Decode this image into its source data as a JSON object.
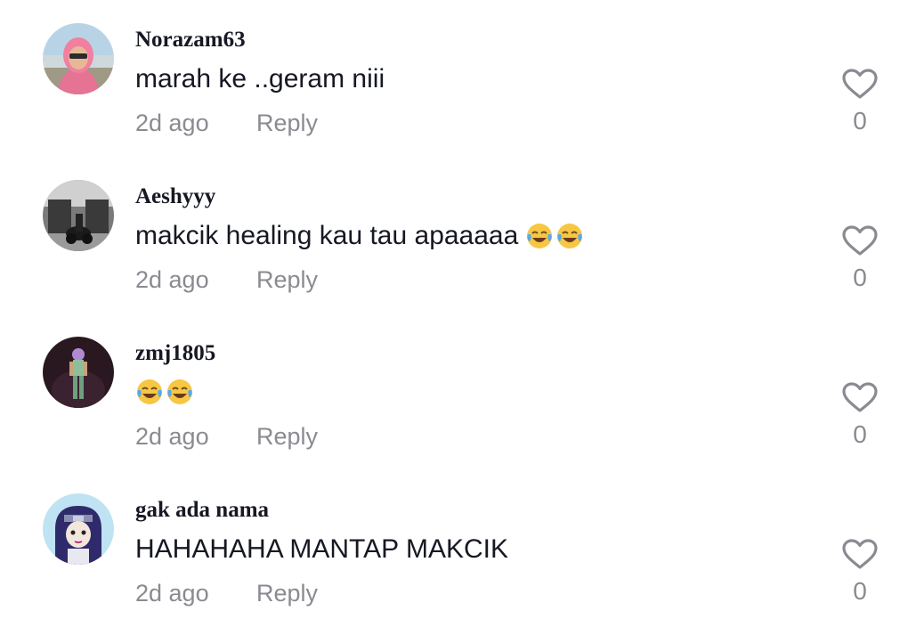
{
  "icons": {
    "like": "heart-outline-icon",
    "emoji": "face-with-tears-of-joy-emoji"
  },
  "colors": {
    "text": "#161823",
    "secondary": "#8a8b91"
  },
  "comments": [
    {
      "username": "Norazam63",
      "text": "marah ke ..geram niii",
      "emoji_count": 0,
      "time": "2d ago",
      "reply_label": "Reply",
      "likes": "0"
    },
    {
      "username": "Aeshyyy",
      "text": "makcik healing kau tau apaaaaa",
      "emoji_count": 2,
      "time": "2d ago",
      "reply_label": "Reply",
      "likes": "0"
    },
    {
      "username": "zmj1805",
      "text": "",
      "emoji_count": 2,
      "time": "2d ago",
      "reply_label": "Reply",
      "likes": "0"
    },
    {
      "username": "gak ada nama",
      "text": "HAHAHAHA MANTAP MAKCIK",
      "emoji_count": 0,
      "time": "2d ago",
      "reply_label": "Reply",
      "likes": "0"
    }
  ]
}
